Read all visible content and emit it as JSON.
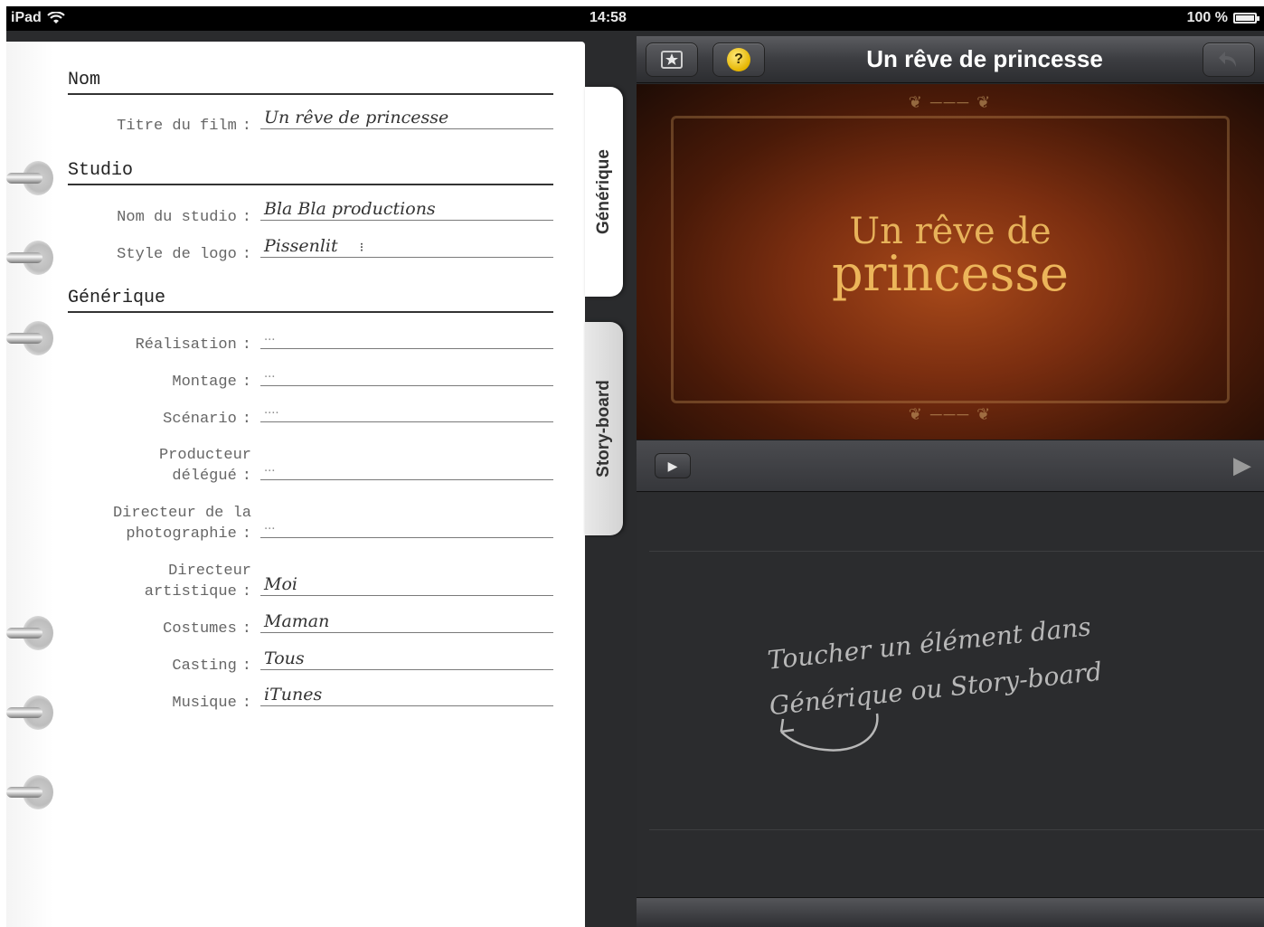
{
  "status_bar": {
    "device": "iPad",
    "wifi_icon": "wifi-icon",
    "time": "14:58",
    "battery": "100 %",
    "battery_icon": "battery-icon"
  },
  "sections": {
    "nom": "Nom",
    "studio": "Studio",
    "generique": "Générique"
  },
  "fields": {
    "titre_label": "Titre du film",
    "titre_value": "Un rêve de princesse",
    "studio_label": "Nom du studio",
    "studio_value": "Bla Bla productions",
    "logo_label": "Style de logo",
    "logo_value": "Pissenlit",
    "realisation_label": "Réalisation",
    "realisation_value": "...",
    "montage_label": "Montage",
    "montage_value": "...",
    "scenario_label": "Scénario",
    "scenario_value": "....",
    "producteur_label_1": "Producteur",
    "producteur_label_2": "délégué",
    "producteur_value": "...",
    "directeur_photo_label_1": "Directeur de la",
    "directeur_photo_label_2": "photographie",
    "directeur_photo_value": "...",
    "directeur_art_label_1": "Directeur",
    "directeur_art_label_2": "artistique",
    "directeur_art_value": "Moi",
    "costumes_label": "Costumes",
    "costumes_value": "Maman",
    "casting_label": "Casting",
    "casting_value": "Tous",
    "musique_label": "Musique",
    "musique_value": "iTunes",
    "colon": ":"
  },
  "tabs": {
    "generique": "Générique",
    "storyboard": "Story-board"
  },
  "toolbar": {
    "title": "Un rêve de princesse",
    "theme_icon": "star-theme-icon",
    "help_icon": "help-icon",
    "help_glyph": "?",
    "undo_icon": "undo-icon"
  },
  "preview": {
    "title_line1": "Un rêve de",
    "title_line2": "princesse"
  },
  "playback": {
    "play_small_icon": "play-icon",
    "play_large_icon": "play-large-icon"
  },
  "board": {
    "hint_line1": "Toucher un élément dans",
    "hint_line2": "Générique ou Story-board"
  },
  "colors": {
    "accent_yellow": "#e5b500",
    "title_gold": "#ecb55a",
    "dark_panel": "#2b2c2e"
  }
}
